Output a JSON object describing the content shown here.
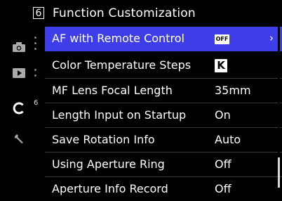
{
  "header": {
    "page_number": "6",
    "title": "Function Customization"
  },
  "sidebar": {
    "icons": [
      "camera-icon",
      "playback-icon",
      "custom-c-icon",
      "wrench-icon"
    ],
    "active_page_number": "6"
  },
  "menu": {
    "items": [
      {
        "label": "AF with Remote Control",
        "value": "OFF",
        "value_type": "badge",
        "selected": true
      },
      {
        "label": "Color Temperature Steps",
        "value": "K",
        "value_type": "badge"
      },
      {
        "label": "MF Lens Focal Length",
        "value": "35mm",
        "value_type": "text"
      },
      {
        "label": "Length Input on Startup",
        "value": "On",
        "value_type": "text"
      },
      {
        "label": "Save Rotation Info",
        "value": "Auto",
        "value_type": "text"
      },
      {
        "label": "Using Aperture Ring",
        "value": "Off",
        "value_type": "text"
      },
      {
        "label": "Aperture Info Record",
        "value": "Off",
        "value_type": "text"
      }
    ],
    "submenu_chevron": "›"
  },
  "colors": {
    "selected_row": "#3e3ee8",
    "background": "#000000",
    "text": "#ffffff"
  }
}
